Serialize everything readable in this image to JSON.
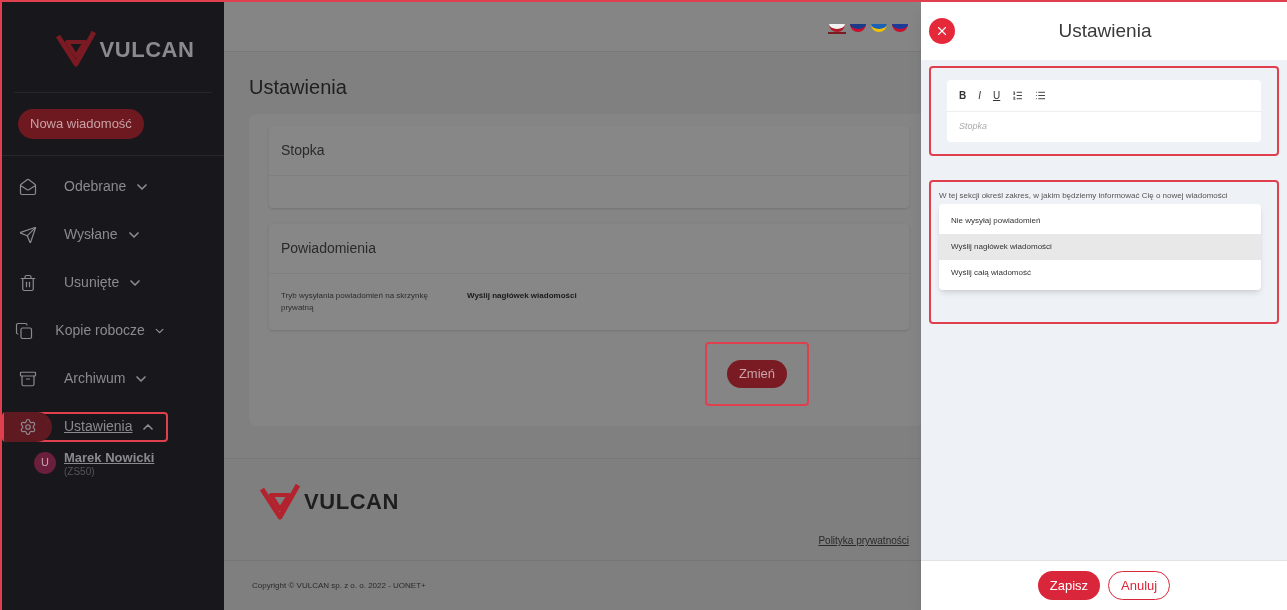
{
  "sidebar": {
    "logo_text": "VULCAN",
    "new_message_button": "Nowa wiadomość",
    "items": [
      {
        "label": "Odebrane",
        "selected": false,
        "expanded": false,
        "highlighted": false
      },
      {
        "label": "Wysłane",
        "selected": false,
        "expanded": false,
        "highlighted": false
      },
      {
        "label": "Usunięte",
        "selected": false,
        "expanded": false,
        "highlighted": false
      },
      {
        "label": "Kopie robocze",
        "selected": false,
        "expanded": false,
        "highlighted": false
      },
      {
        "label": "Archiwum",
        "selected": false,
        "expanded": false,
        "highlighted": false
      },
      {
        "label": "Ustawienia",
        "selected": true,
        "expanded": true,
        "highlighted": true
      }
    ],
    "user": {
      "initial": "U",
      "name": "Marek Nowicki",
      "code": "(ZS50)"
    }
  },
  "languages": [
    {
      "selected": true
    },
    {
      "selected": false
    },
    {
      "selected": false
    },
    {
      "selected": false
    }
  ],
  "page": {
    "title": "Ustawienia",
    "sections": [
      {
        "title": "Stopka"
      },
      {
        "title": "Powiadomienia",
        "rows": [
          {
            "label": "Tryb wysyłania powiadomień na skrzynkę prywatną",
            "value": "Wyślij nagłówek wiadomości"
          }
        ]
      }
    ],
    "change_button": {
      "label": "Zmień",
      "highlighted": true
    }
  },
  "footer": {
    "logo_text": "VULCAN",
    "privacy_link": "Polityka prywatności",
    "copyright": "Copyright © VULCAN sp. z o. o. 2022 - UONET+"
  },
  "panel": {
    "title": "Ustawienia",
    "editor": {
      "highlighted": true,
      "toolbar": [
        {
          "kind": "bold",
          "label": "B"
        },
        {
          "kind": "italic",
          "label": "I"
        },
        {
          "kind": "underline",
          "label": "U"
        },
        {
          "kind": "ordered-list"
        },
        {
          "kind": "bullet-list"
        }
      ],
      "placeholder": "Stopka"
    },
    "notifications": {
      "highlighted": true,
      "description": "W tej sekcji określ zakres, w jakim będziemy informować Cię o nowej wiadomości",
      "options": [
        {
          "label": "Nie wysyłaj powiadomień",
          "selected": false
        },
        {
          "label": "Wyślij nagłówek wiadomości",
          "selected": true
        },
        {
          "label": "Wyślij całą wiadomość",
          "selected": false
        }
      ]
    },
    "buttons": {
      "save": "Zapisz",
      "cancel": "Anuluj"
    }
  }
}
